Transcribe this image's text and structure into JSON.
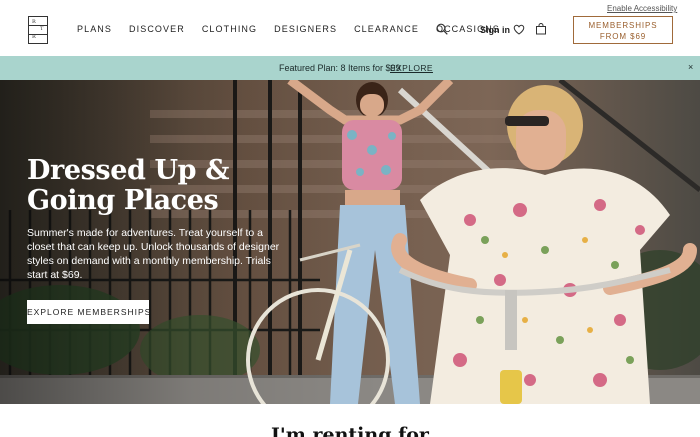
{
  "header": {
    "logo_letters": [
      "R",
      "T",
      "R"
    ],
    "nav": [
      {
        "label": "PLANS"
      },
      {
        "label": "DISCOVER"
      },
      {
        "label": "CLOTHING"
      },
      {
        "label": "DESIGNERS"
      },
      {
        "label": "CLEARANCE"
      },
      {
        "label": "OCCASIONS"
      }
    ],
    "icons": {
      "search": "search-icon",
      "heart": "heart-icon",
      "bag": "shopping-bag-icon"
    },
    "accessibility_link": "Enable Accessibility",
    "sign_in": "Sign in",
    "membership_button": {
      "line1": "MEMBERSHIPS",
      "line2": "FROM $69"
    },
    "accent_color": "#9a5f2d"
  },
  "promo": {
    "text": "Featured Plan: 8 Items for $99",
    "link": "EXPLORE",
    "close": "×",
    "background": "#a9d4cd"
  },
  "hero": {
    "title_line1": "Dressed Up &",
    "title_line2": "Going Places",
    "body": "Summer's made for adventures. Treat yourself to a closet that can keep up. Unlock thousands of designer styles on demand with a monthly membership. Trials start at $69.",
    "cta": "EXPLORE MEMBERSHIPS"
  },
  "section": {
    "heading": "I'm renting for"
  }
}
